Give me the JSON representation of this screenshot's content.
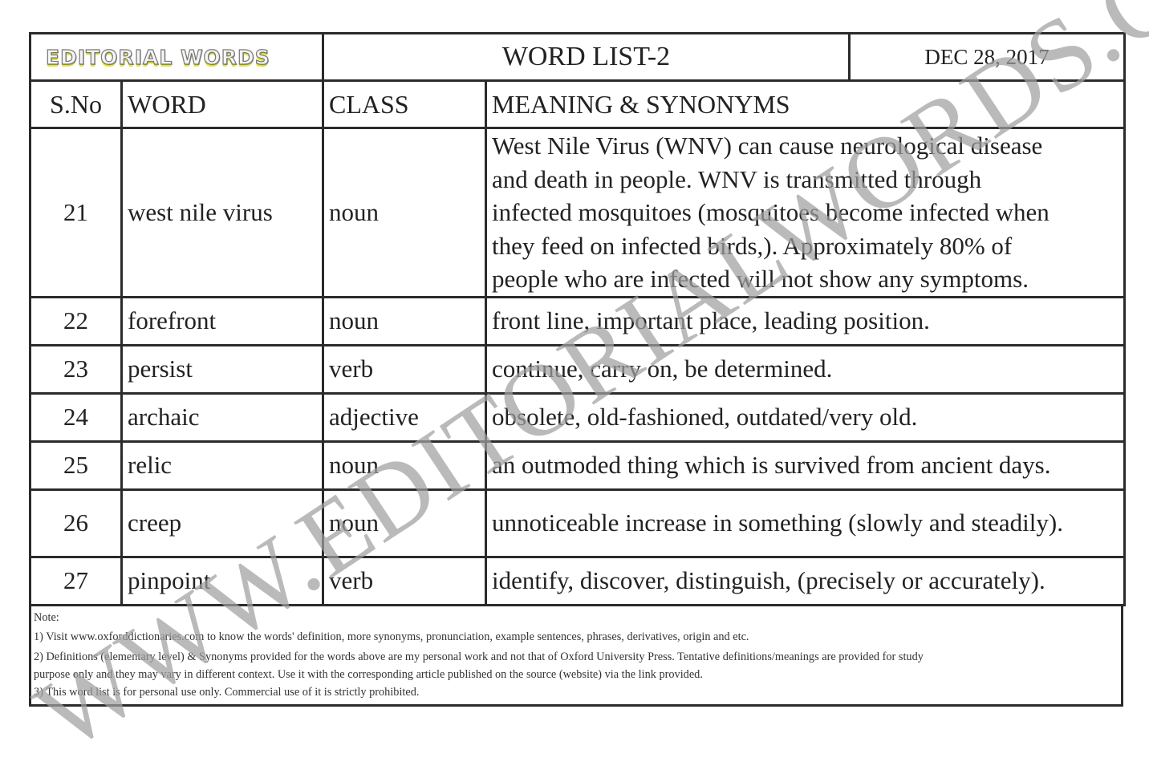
{
  "header": {
    "logo_text": "EDITORIAL WORDS",
    "title": "WORD LIST-2",
    "date": "DEC 28, 2017"
  },
  "columns": {
    "sno": "S.No",
    "word": "WORD",
    "class": "CLASS",
    "meaning": "MEANING & SYNONYMS"
  },
  "rows": [
    {
      "sno": "21",
      "word": "west nile virus",
      "class": "noun",
      "meaning_lines": [
        "West Nile Virus (WNV) can cause neurological disease",
        "and death in people. WNV is transmitted through",
        "infected mosquitoes (mosquitoes become infected when",
        "they feed on infected birds,). Approximately 80% of",
        "people who are infected will not show any symptoms."
      ]
    },
    {
      "sno": "22",
      "word": "forefront",
      "class": "noun",
      "meaning": "front line, important place, leading position."
    },
    {
      "sno": "23",
      "word": "persist",
      "class": "verb",
      "meaning": "continue, carry on, be determined."
    },
    {
      "sno": "24",
      "word": "archaic",
      "class": "adjective",
      "meaning": "obsolete, old-fashioned, outdated/very old."
    },
    {
      "sno": "25",
      "word": "relic",
      "class": "noun",
      "meaning": "an outmoded thing which is survived from ancient days."
    },
    {
      "sno": "26",
      "word": "creep",
      "class": "noun",
      "meaning": "unnoticeable increase in something (slowly and steadily)."
    },
    {
      "sno": "27",
      "word": "pinpoint",
      "class": "verb",
      "meaning": "identify, discover, distinguish, (precisely or accurately)."
    }
  ],
  "notes": {
    "heading": "Note:",
    "lines": [
      "1) Visit www.oxforddictionaries.com to know the words' definition, more synonyms, pronunciation, example sentences, phrases, derivatives, origin and etc.",
      "2) Definitions (elementary level) & Synonyms provided for the words above are my personal work and not that of Oxford University Press. Tentative definitions/meanings are provided for study",
      "purpose only and they may vary in different context. Use it with the corresponding article published on the source (website) via the link provided.",
      "3) This word list is for personal use only. Commercial use of it is strictly prohibited."
    ]
  },
  "watermark": "WWW.EDITORIALWORDS.COM"
}
